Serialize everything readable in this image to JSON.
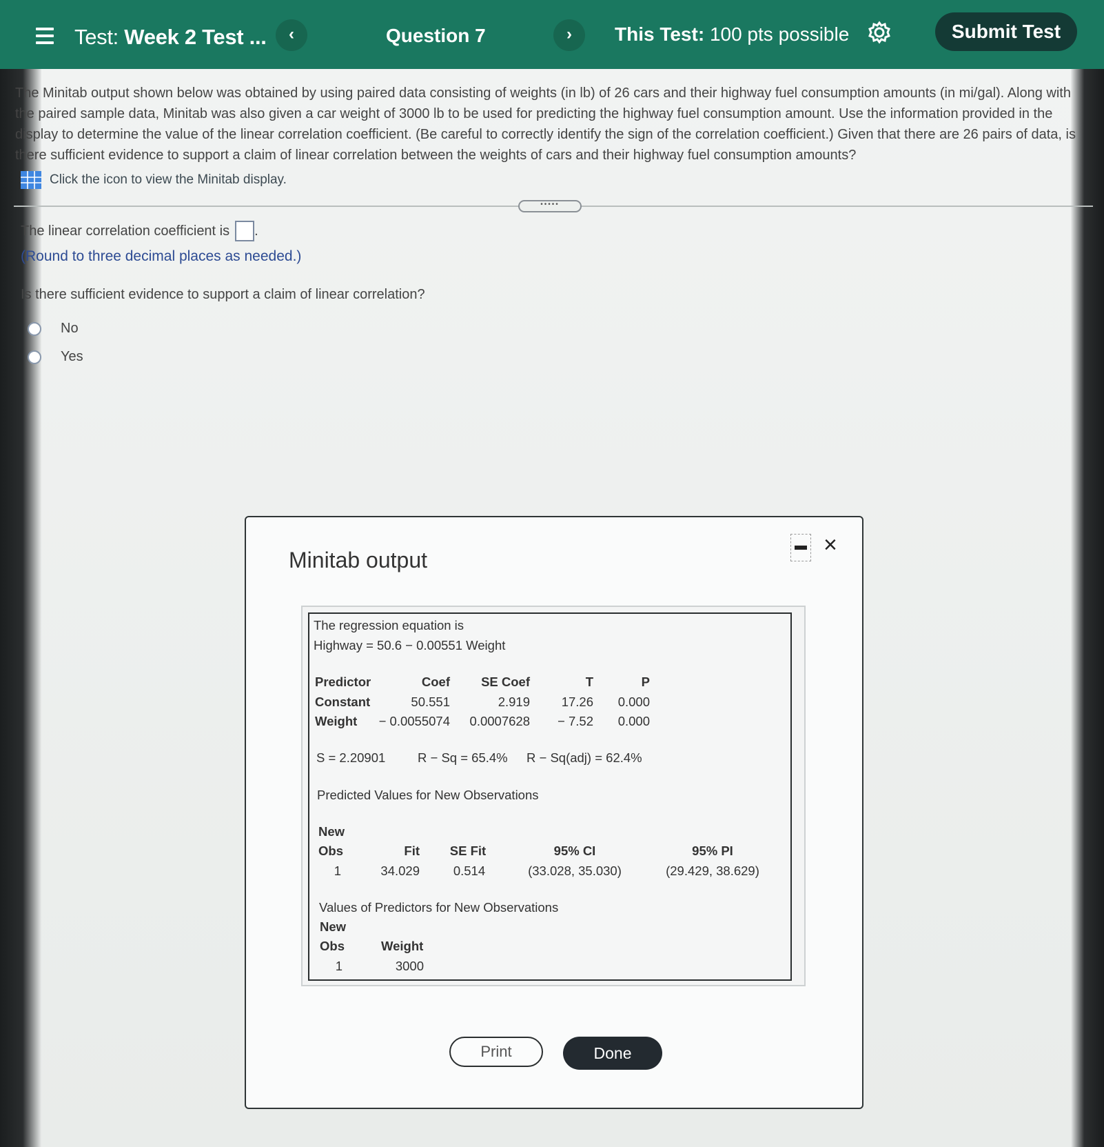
{
  "header": {
    "test_label": "Test:",
    "test_name": "Week 2 Test ...",
    "prev_symbol": "‹",
    "question_title": "Question 7",
    "next_symbol": "›",
    "test_points_label": "This Test:",
    "test_points_value": "100 pts possible",
    "submit_label": "Submit Test",
    "header_color": "#1a7860"
  },
  "question": {
    "text": "The Minitab output shown below was obtained by using paired data consisting of weights (in lb) of 26 cars and their highway fuel consumption amounts (in mi/gal). Along with the paired sample data, Minitab was also given a car weight of 3000 lb to be used for predicting the highway fuel consumption amount. Use the information provided in the display to determine the value of the linear correlation coefficient. (Be careful to correctly identify the sign of the correlation coefficient.) Given that there are 26 pairs of data, is there sufficient evidence to support a claim of linear correlation between the weights of cars and their highway fuel consumption amounts?",
    "link_text": "Click the icon to view the Minitab display.",
    "handle_text": "•••••"
  },
  "answer": {
    "prompt": "The linear correlation coefficient is",
    "period": ".",
    "hint": "(Round to three decimal places as needed.)",
    "question2": "Is there sufficient evidence to support a claim of linear correlation?",
    "options": [
      "No",
      "Yes"
    ]
  },
  "dialog": {
    "title": "Minitab output",
    "close_symbol": "×",
    "print_label": "Print",
    "done_label": "Done",
    "output": {
      "eq_line1": "The regression equation is",
      "eq_line2": "Highway = 50.6 − 0.00551 Weight",
      "headers": [
        "Predictor",
        "Coef",
        "SE Coef",
        "T",
        "P"
      ],
      "rows": [
        [
          "Constant",
          "50.551",
          "2.919",
          "17.26",
          "0.000"
        ],
        [
          "Weight",
          "− 0.0055074",
          "0.0007628",
          "− 7.52",
          "0.000"
        ]
      ],
      "s": "S = 2.20901",
      "rsq": "R − Sq = 65.4%",
      "rsq_adj": "R − Sq(adj) = 62.4%",
      "pred_title": "Predicted Values for New Observations",
      "pred_new": "New",
      "pred_headers": [
        "Obs",
        "Fit",
        "SE Fit",
        "95% CI",
        "95% PI"
      ],
      "pred_row": [
        "1",
        "34.029",
        "0.514",
        "(33.028, 35.030)",
        "(29.429, 38.629)"
      ],
      "val_title": "Values of Predictors for New Observations",
      "val_new": "New",
      "val_headers": [
        "Obs",
        "Weight"
      ],
      "val_row": [
        "1",
        "3000"
      ]
    }
  }
}
